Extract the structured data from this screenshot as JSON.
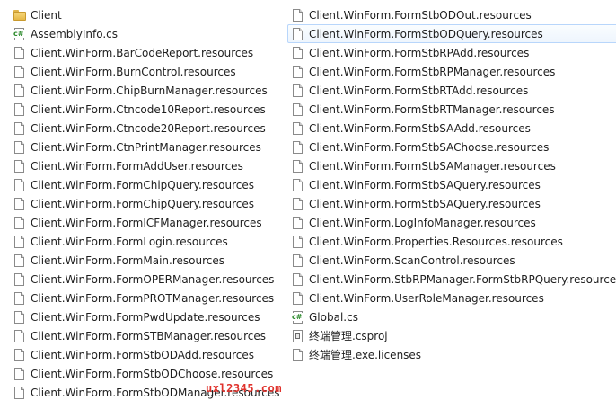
{
  "left_column": [
    {
      "name": "Client",
      "icon": "folder-icon"
    },
    {
      "name": "AssemblyInfo.cs",
      "icon": "csharp-file-icon"
    },
    {
      "name": "Client.WinForm.BarCodeReport.resources",
      "icon": "document-icon"
    },
    {
      "name": "Client.WinForm.BurnControl.resources",
      "icon": "document-icon"
    },
    {
      "name": "Client.WinForm.ChipBurnManager.resources",
      "icon": "document-icon"
    },
    {
      "name": "Client.WinForm.Ctncode10Report.resources",
      "icon": "document-icon"
    },
    {
      "name": "Client.WinForm.Ctncode20Report.resources",
      "icon": "document-icon"
    },
    {
      "name": "Client.WinForm.CtnPrintManager.resources",
      "icon": "document-icon"
    },
    {
      "name": "Client.WinForm.FormAddUser.resources",
      "icon": "document-icon"
    },
    {
      "name": "Client.WinForm.FormChipQuery.resources",
      "icon": "document-icon"
    },
    {
      "name": "Client.WinForm.FormChipQuery.resources",
      "icon": "document-icon"
    },
    {
      "name": "Client.WinForm.FormICFManager.resources",
      "icon": "document-icon"
    },
    {
      "name": "Client.WinForm.FormLogin.resources",
      "icon": "document-icon"
    },
    {
      "name": "Client.WinForm.FormMain.resources",
      "icon": "document-icon"
    },
    {
      "name": "Client.WinForm.FormOPERManager.resources",
      "icon": "document-icon"
    },
    {
      "name": "Client.WinForm.FormPROTManager.resources",
      "icon": "document-icon"
    },
    {
      "name": "Client.WinForm.FormPwdUpdate.resources",
      "icon": "document-icon"
    },
    {
      "name": "Client.WinForm.FormSTBManager.resources",
      "icon": "document-icon"
    },
    {
      "name": "Client.WinForm.FormStbODAdd.resources",
      "icon": "document-icon"
    },
    {
      "name": "Client.WinForm.FormStbODChoose.resources",
      "icon": "document-icon"
    },
    {
      "name": "Client.WinForm.FormStbODManager.resources",
      "icon": "document-icon"
    }
  ],
  "right_column": [
    {
      "name": "Client.WinForm.FormStbODOut.resources",
      "icon": "document-icon"
    },
    {
      "name": "Client.WinForm.FormStbODQuery.resources",
      "icon": "document-icon",
      "selected": true
    },
    {
      "name": "Client.WinForm.FormStbRPAdd.resources",
      "icon": "document-icon"
    },
    {
      "name": "Client.WinForm.FormStbRPManager.resources",
      "icon": "document-icon"
    },
    {
      "name": "Client.WinForm.FormStbRTAdd.resources",
      "icon": "document-icon"
    },
    {
      "name": "Client.WinForm.FormStbRTManager.resources",
      "icon": "document-icon"
    },
    {
      "name": "Client.WinForm.FormStbSAAdd.resources",
      "icon": "document-icon"
    },
    {
      "name": "Client.WinForm.FormStbSAChoose.resources",
      "icon": "document-icon"
    },
    {
      "name": "Client.WinForm.FormStbSAManager.resources",
      "icon": "document-icon"
    },
    {
      "name": "Client.WinForm.FormStbSAQuery.resources",
      "icon": "document-icon"
    },
    {
      "name": "Client.WinForm.FormStbSAQuery.resources",
      "icon": "document-icon"
    },
    {
      "name": "Client.WinForm.LogInfoManager.resources",
      "icon": "document-icon"
    },
    {
      "name": "Client.WinForm.Properties.Resources.resources",
      "icon": "document-icon"
    },
    {
      "name": "Client.WinForm.ScanControl.resources",
      "icon": "document-icon"
    },
    {
      "name": "Client.WinForm.StbRPManager.FormStbRPQuery.resources",
      "icon": "document-icon"
    },
    {
      "name": "Client.WinForm.UserRoleManager.resources",
      "icon": "document-icon"
    },
    {
      "name": "Global.cs",
      "icon": "csharp-file-icon"
    },
    {
      "name": "终端管理.csproj",
      "icon": "project-file-icon"
    },
    {
      "name": "终端管理.exe.licenses",
      "icon": "document-icon"
    }
  ],
  "watermark": "uxl2345.com",
  "colors": {
    "selection_border": "#b8d6fb",
    "watermark": "#e0322c",
    "folder": "#e6b847",
    "csharp": "#2b8a2b"
  }
}
